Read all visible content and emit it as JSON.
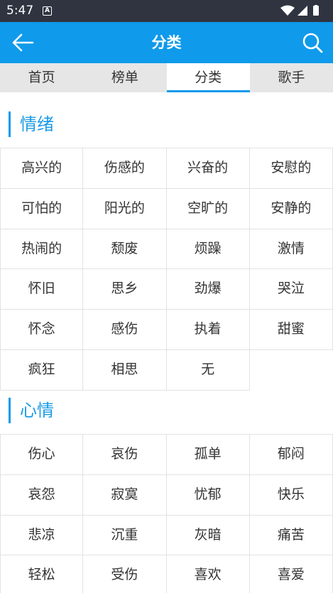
{
  "status_bar": {
    "time": "5:47",
    "notification_letter": "A"
  },
  "app_bar": {
    "title": "分类"
  },
  "tabs": [
    {
      "label": "首页",
      "active": false
    },
    {
      "label": "榜单",
      "active": false
    },
    {
      "label": "分类",
      "active": true
    },
    {
      "label": "歌手",
      "active": false
    }
  ],
  "sections": [
    {
      "title": "情绪",
      "items": [
        "高兴的",
        "伤感的",
        "兴奋的",
        "安慰的",
        "可怕的",
        "阳光的",
        "空旷的",
        "安静的",
        "热闹的",
        "颓废",
        "烦躁",
        "激情",
        "怀旧",
        "思乡",
        "劲爆",
        "哭泣",
        "怀念",
        "感伤",
        "执着",
        "甜蜜",
        "疯狂",
        "相思",
        "无"
      ]
    },
    {
      "title": "心情",
      "items": [
        "伤心",
        "哀伤",
        "孤单",
        "郁闷",
        "哀怨",
        "寂寞",
        "忧郁",
        "快乐",
        "悲凉",
        "沉重",
        "灰暗",
        "痛苦",
        "轻松",
        "受伤",
        "喜欢",
        "喜爱"
      ]
    }
  ],
  "colors": {
    "accent": "#0f9aeb",
    "status_bar": "#2f3440",
    "tab_bg": "#e6e6e6",
    "grid_line": "#e2e2e2"
  }
}
